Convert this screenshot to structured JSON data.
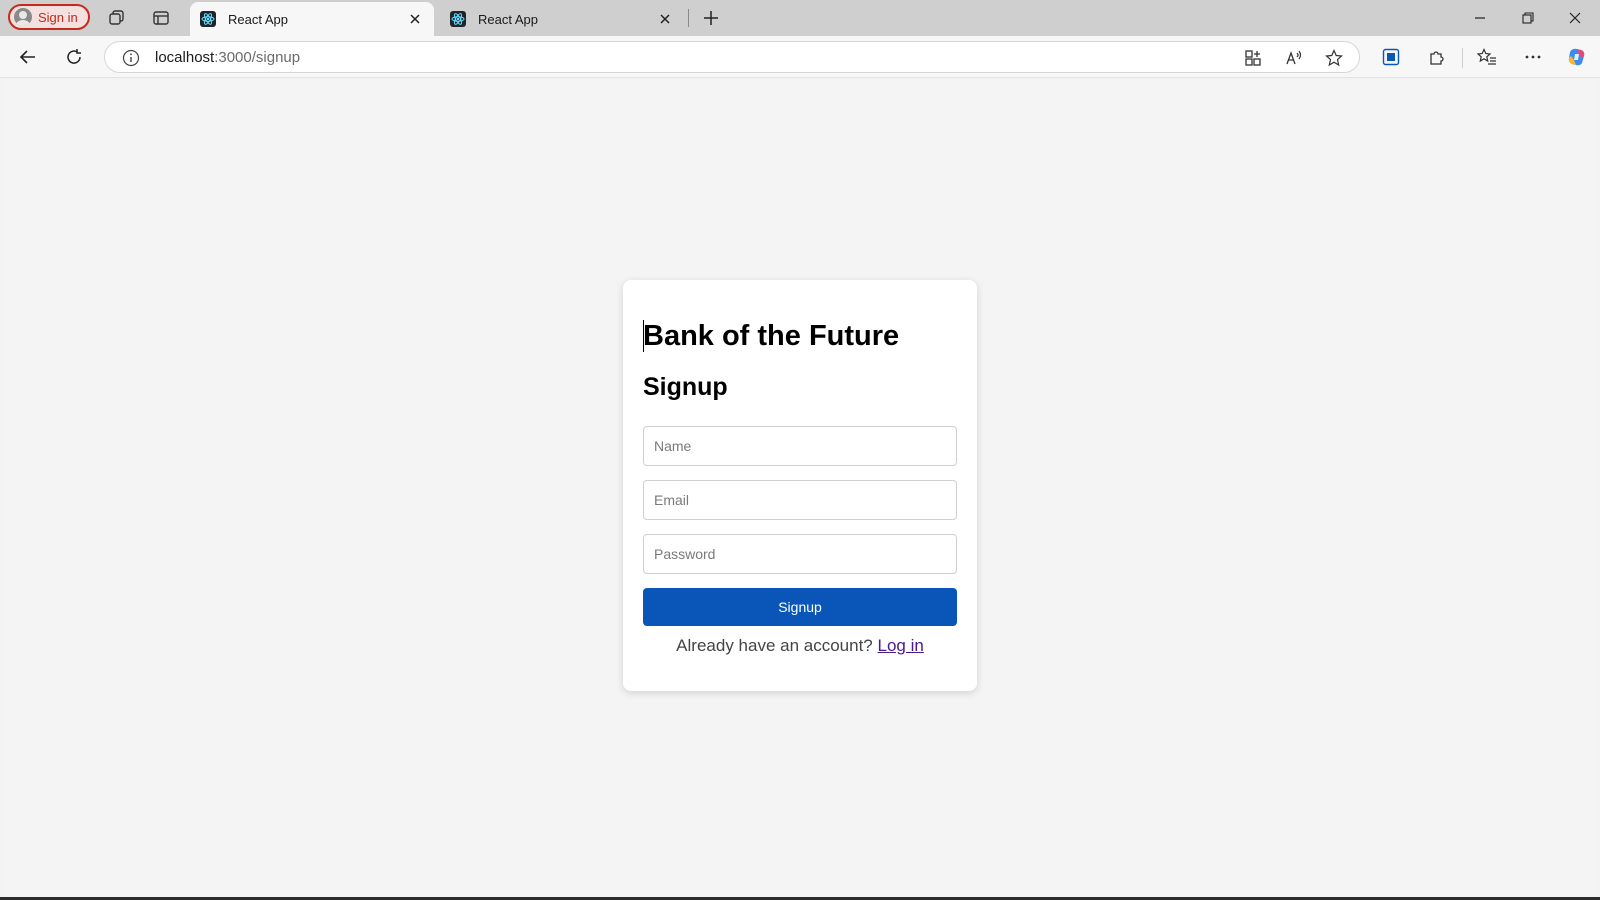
{
  "browser": {
    "signin_label": "Sign in",
    "tabs": [
      {
        "title": "React App",
        "active": true
      },
      {
        "title": "React App",
        "active": false
      }
    ],
    "url_host": "localhost",
    "url_path": ":3000/signup"
  },
  "page": {
    "app_title": "Bank of the Future",
    "form_title": "Signup",
    "fields": {
      "name_placeholder": "Name",
      "email_placeholder": "Email",
      "password_placeholder": "Password"
    },
    "submit_label": "Signup",
    "login_prompt": "Already have an account?",
    "login_link": "Log in"
  },
  "colors": {
    "primary_button": "#0a56b8",
    "link": "#4b1a8f",
    "signin_accent": "#c42b1c"
  }
}
